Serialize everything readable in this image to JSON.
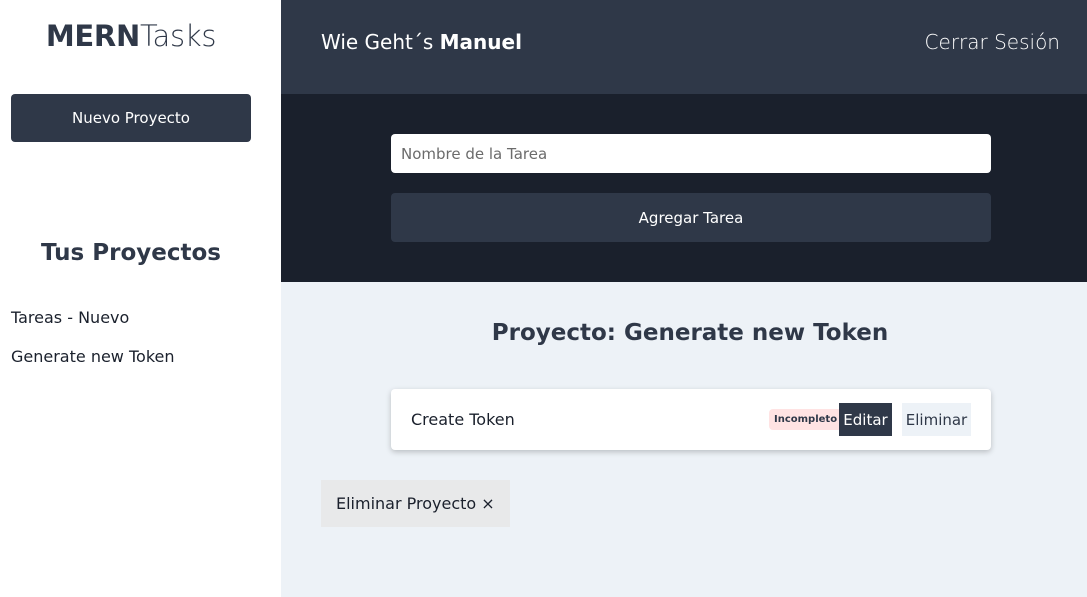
{
  "sidebar": {
    "logo_bold": "MERN",
    "logo_light": "Tasks",
    "new_project_label": "Nuevo Proyecto",
    "projects_title": "Tus Proyectos",
    "projects": [
      {
        "name": "Tareas - Nuevo"
      },
      {
        "name": "Generate new Token"
      }
    ]
  },
  "header": {
    "greeting": "Wie Geht´s ",
    "user_name": "Manuel",
    "logout_label": "Cerrar Sesión"
  },
  "form": {
    "task_placeholder": "Nombre de la Tarea",
    "task_value": "",
    "add_task_label": "Agregar Tarea"
  },
  "main": {
    "project_title": "Proyecto: Generate new Token",
    "tasks": [
      {
        "name": "Create Token",
        "status": "Incompleto",
        "edit_label": "Editar",
        "delete_label": "Eliminar"
      }
    ],
    "delete_project_label": "Eliminar Proyecto ×"
  },
  "colors": {
    "primary": "#2f3848",
    "dark": "#1a202c",
    "background": "#edf2f7",
    "incomplete_badge": "#ffe3e3"
  }
}
